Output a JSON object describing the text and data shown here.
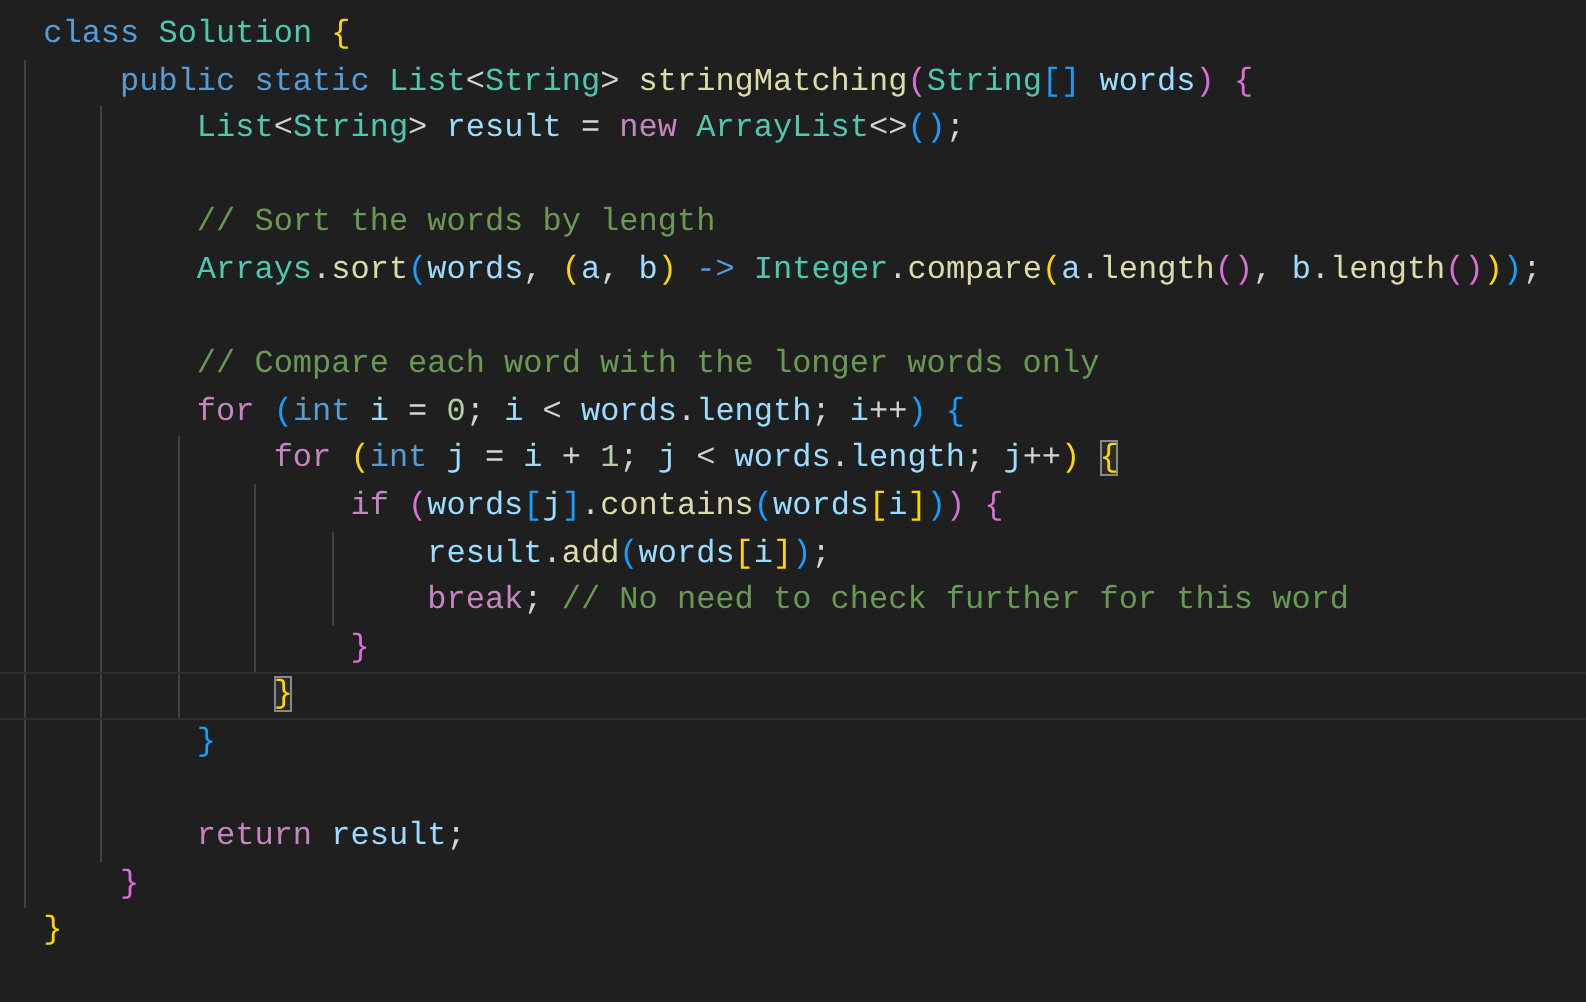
{
  "editor": {
    "blocks": [
      {
        "lines": [
          {
            "cursor": false,
            "tokens": [
              {
                "text": "class",
                "kind": "kw"
              },
              {
                "text": " Solution",
                "kind": "type"
              },
              {
                "text": " {",
                "kind": "b1"
              }
            ]
          },
          {
            "cursor": false,
            "tokens": [
              {
                "text": "    public static",
                "kind": "kw"
              },
              {
                "text": " List",
                "kind": "type"
              },
              {
                "text": "<",
                "kind": "pl"
              },
              {
                "text": "String",
                "kind": "type"
              },
              {
                "text": ">",
                "kind": "pl"
              },
              {
                "text": " stringMatching",
                "kind": "fn"
              },
              {
                "text": "(",
                "kind": "b2"
              },
              {
                "text": "String",
                "kind": "type"
              },
              {
                "text": "[]",
                "kind": "b3"
              },
              {
                "text": " words",
                "kind": "var"
              },
              {
                "text": ")",
                "kind": "b2"
              },
              {
                "text": " {",
                "kind": "b2"
              }
            ]
          },
          {
            "cursor": false,
            "tokens": [
              {
                "text": "        List",
                "kind": "type"
              },
              {
                "text": "<",
                "kind": "pl"
              },
              {
                "text": "String",
                "kind": "type"
              },
              {
                "text": ">",
                "kind": "pl"
              },
              {
                "text": " result",
                "kind": "var"
              },
              {
                "text": " =",
                "kind": "pl"
              },
              {
                "text": " new",
                "kind": "ctrl"
              },
              {
                "text": " ArrayList",
                "kind": "type"
              },
              {
                "text": "<>",
                "kind": "pl"
              },
              {
                "text": "()",
                "kind": "b3"
              },
              {
                "text": ";",
                "kind": "pl"
              }
            ]
          }
        ]
      },
      {
        "lines": [
          {
            "cursor": false,
            "tokens": [
              {
                "text": "        // Sort the words by length",
                "kind": "com"
              }
            ]
          },
          {
            "cursor": false,
            "tokens": [
              {
                "text": "        Arrays",
                "kind": "type"
              },
              {
                "text": ".",
                "kind": "pl"
              },
              {
                "text": "sort",
                "kind": "fn"
              },
              {
                "text": "(",
                "kind": "b3"
              },
              {
                "text": "words",
                "kind": "var"
              },
              {
                "text": ",",
                "kind": "pl"
              },
              {
                "text": " (",
                "kind": "b1"
              },
              {
                "text": "a",
                "kind": "var"
              },
              {
                "text": ",",
                "kind": "pl"
              },
              {
                "text": " b",
                "kind": "var"
              },
              {
                "text": ")",
                "kind": "b1"
              },
              {
                "text": " ->",
                "kind": "kw"
              },
              {
                "text": " Integer",
                "kind": "type"
              },
              {
                "text": ".",
                "kind": "pl"
              },
              {
                "text": "compare",
                "kind": "fn"
              },
              {
                "text": "(",
                "kind": "b1"
              },
              {
                "text": "a",
                "kind": "var"
              },
              {
                "text": ".",
                "kind": "pl"
              },
              {
                "text": "length",
                "kind": "fn"
              },
              {
                "text": "()",
                "kind": "b2"
              },
              {
                "text": ",",
                "kind": "pl"
              },
              {
                "text": " b",
                "kind": "var"
              },
              {
                "text": ".",
                "kind": "pl"
              },
              {
                "text": "length",
                "kind": "fn"
              },
              {
                "text": "()",
                "kind": "b2"
              },
              {
                "text": ")",
                "kind": "b1"
              },
              {
                "text": ")",
                "kind": "b3"
              },
              {
                "text": ";",
                "kind": "pl"
              }
            ]
          }
        ]
      },
      {
        "lines": [
          {
            "cursor": false,
            "tokens": [
              {
                "text": "        // Compare each word with the longer words only",
                "kind": "com"
              }
            ]
          },
          {
            "cursor": false,
            "tokens": [
              {
                "text": "        for",
                "kind": "ctrl"
              },
              {
                "text": " (",
                "kind": "b3"
              },
              {
                "text": "int",
                "kind": "kw"
              },
              {
                "text": " i",
                "kind": "var"
              },
              {
                "text": " =",
                "kind": "pl"
              },
              {
                "text": " 0",
                "kind": "num"
              },
              {
                "text": ";",
                "kind": "pl"
              },
              {
                "text": " i",
                "kind": "var"
              },
              {
                "text": " <",
                "kind": "pl"
              },
              {
                "text": " words",
                "kind": "var"
              },
              {
                "text": ".",
                "kind": "pl"
              },
              {
                "text": "length",
                "kind": "var"
              },
              {
                "text": ";",
                "kind": "pl"
              },
              {
                "text": " i",
                "kind": "var"
              },
              {
                "text": "++",
                "kind": "pl"
              },
              {
                "text": ")",
                "kind": "b3"
              },
              {
                "text": " {",
                "kind": "b3"
              }
            ]
          },
          {
            "cursor": false,
            "tokens": [
              {
                "text": "            for",
                "kind": "ctrl"
              },
              {
                "text": " (",
                "kind": "b1"
              },
              {
                "text": "int",
                "kind": "kw"
              },
              {
                "text": " j",
                "kind": "var"
              },
              {
                "text": " =",
                "kind": "pl"
              },
              {
                "text": " i",
                "kind": "var"
              },
              {
                "text": " +",
                "kind": "pl"
              },
              {
                "text": " 1",
                "kind": "num"
              },
              {
                "text": ";",
                "kind": "pl"
              },
              {
                "text": " j",
                "kind": "var"
              },
              {
                "text": " <",
                "kind": "pl"
              },
              {
                "text": " words",
                "kind": "var"
              },
              {
                "text": ".",
                "kind": "pl"
              },
              {
                "text": "length",
                "kind": "var"
              },
              {
                "text": ";",
                "kind": "pl"
              },
              {
                "text": " j",
                "kind": "var"
              },
              {
                "text": "++",
                "kind": "pl"
              },
              {
                "text": ")",
                "kind": "b1"
              },
              {
                "text": " {",
                "kind": "match"
              }
            ]
          },
          {
            "cursor": false,
            "tokens": [
              {
                "text": "                if",
                "kind": "ctrl"
              },
              {
                "text": " (",
                "kind": "b2"
              },
              {
                "text": "words",
                "kind": "var"
              },
              {
                "text": "[",
                "kind": "b3"
              },
              {
                "text": "j",
                "kind": "var"
              },
              {
                "text": "]",
                "kind": "b3"
              },
              {
                "text": ".",
                "kind": "pl"
              },
              {
                "text": "contains",
                "kind": "fn"
              },
              {
                "text": "(",
                "kind": "b3"
              },
              {
                "text": "words",
                "kind": "var"
              },
              {
                "text": "[",
                "kind": "b1"
              },
              {
                "text": "i",
                "kind": "var"
              },
              {
                "text": "]",
                "kind": "b1"
              },
              {
                "text": ")",
                "kind": "b3"
              },
              {
                "text": ")",
                "kind": "b2"
              },
              {
                "text": " {",
                "kind": "b2"
              }
            ]
          },
          {
            "cursor": false,
            "tokens": [
              {
                "text": "                    result",
                "kind": "var"
              },
              {
                "text": ".",
                "kind": "pl"
              },
              {
                "text": "add",
                "kind": "fn"
              },
              {
                "text": "(",
                "kind": "b3"
              },
              {
                "text": "words",
                "kind": "var"
              },
              {
                "text": "[",
                "kind": "b1"
              },
              {
                "text": "i",
                "kind": "var"
              },
              {
                "text": "]",
                "kind": "b1"
              },
              {
                "text": ")",
                "kind": "b3"
              },
              {
                "text": ";",
                "kind": "pl"
              }
            ]
          },
          {
            "cursor": false,
            "tokens": [
              {
                "text": "                    break",
                "kind": "ctrl"
              },
              {
                "text": ";",
                "kind": "pl"
              },
              {
                "text": " // No need to check further for this word",
                "kind": "com"
              }
            ]
          },
          {
            "cursor": false,
            "tokens": [
              {
                "text": "                }",
                "kind": "b2"
              }
            ]
          },
          {
            "cursor": true,
            "tokens": [
              {
                "text": "            }",
                "kind": "match"
              }
            ]
          },
          {
            "cursor": false,
            "tokens": [
              {
                "text": "        }",
                "kind": "b3"
              }
            ]
          }
        ]
      },
      {
        "lines": [
          {
            "cursor": false,
            "tokens": [
              {
                "text": "        return",
                "kind": "ctrl"
              },
              {
                "text": " result",
                "kind": "var"
              },
              {
                "text": ";",
                "kind": "pl"
              }
            ]
          },
          {
            "cursor": false,
            "tokens": [
              {
                "text": "    }",
                "kind": "b2"
              }
            ]
          },
          {
            "cursor": false,
            "tokens": [
              {
                "text": "}",
                "kind": "b1"
              }
            ]
          }
        ]
      }
    ]
  }
}
